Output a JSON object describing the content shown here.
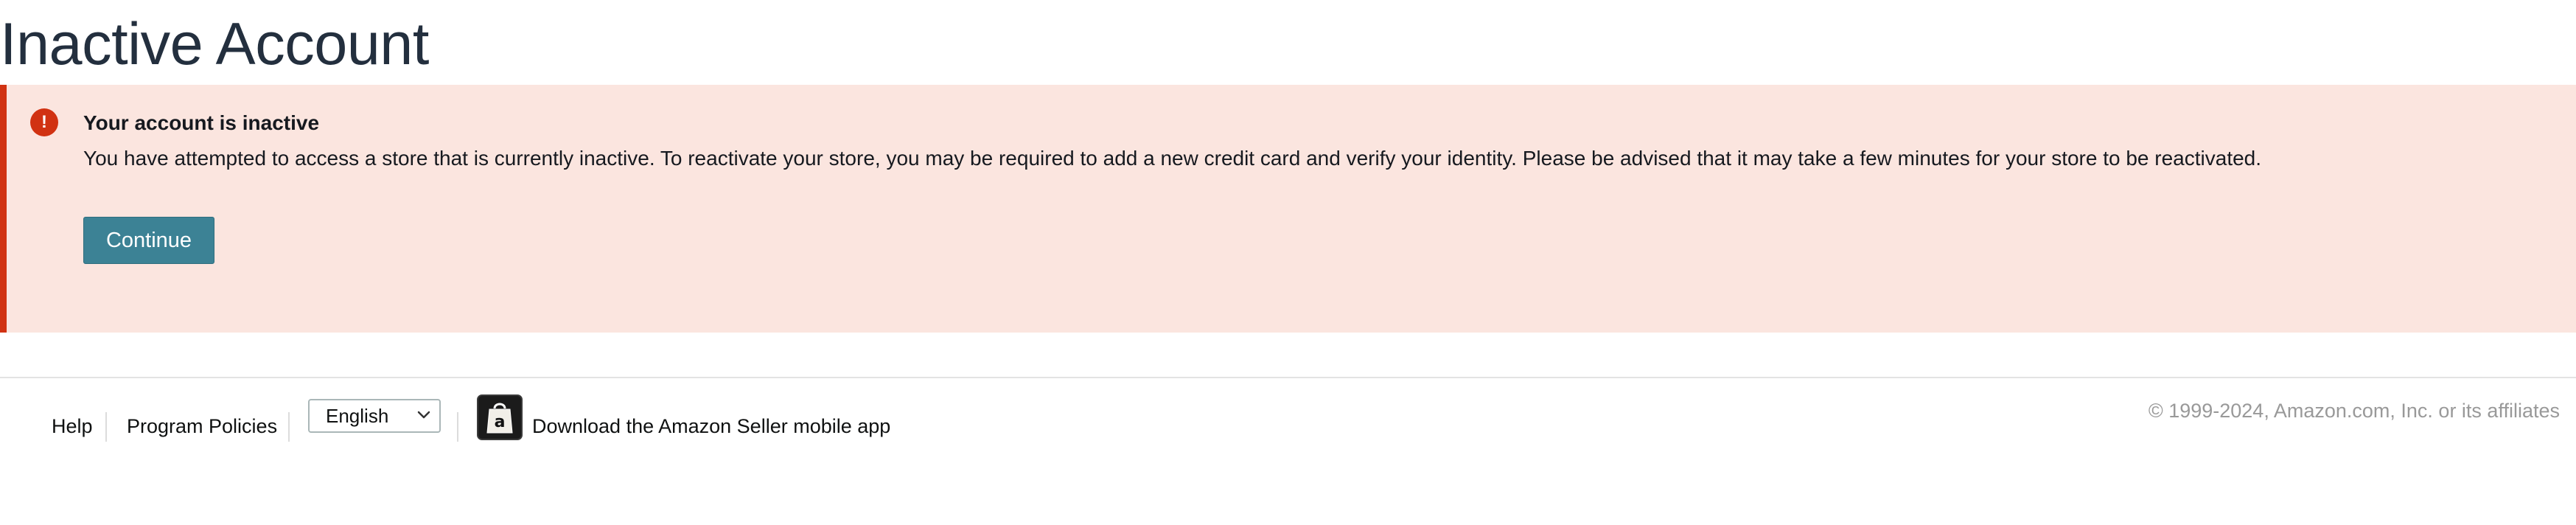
{
  "page": {
    "title": "Inactive Account"
  },
  "alert": {
    "icon": "exclamation-circle-icon",
    "icon_glyph": "!",
    "heading": "Your account is inactive",
    "body": "You have attempted to access a store that is currently inactive. To reactivate your store, you may be required to add a new credit card and verify your identity. Please be advised that it may take a few minutes for your store to be reactivated.",
    "continue_label": "Continue",
    "colors": {
      "background": "#fbe5df",
      "border": "#d13212",
      "button": "#3c8295"
    }
  },
  "footer": {
    "help_label": "Help",
    "program_policies_label": "Program Policies",
    "language": {
      "selected": "English"
    },
    "app_icon": "amazon-seller-app-icon",
    "app_icon_letter": "a",
    "app_download_label": "Download the Amazon Seller mobile app",
    "copyright": "© 1999-2024, Amazon.com, Inc. or its affiliates"
  }
}
